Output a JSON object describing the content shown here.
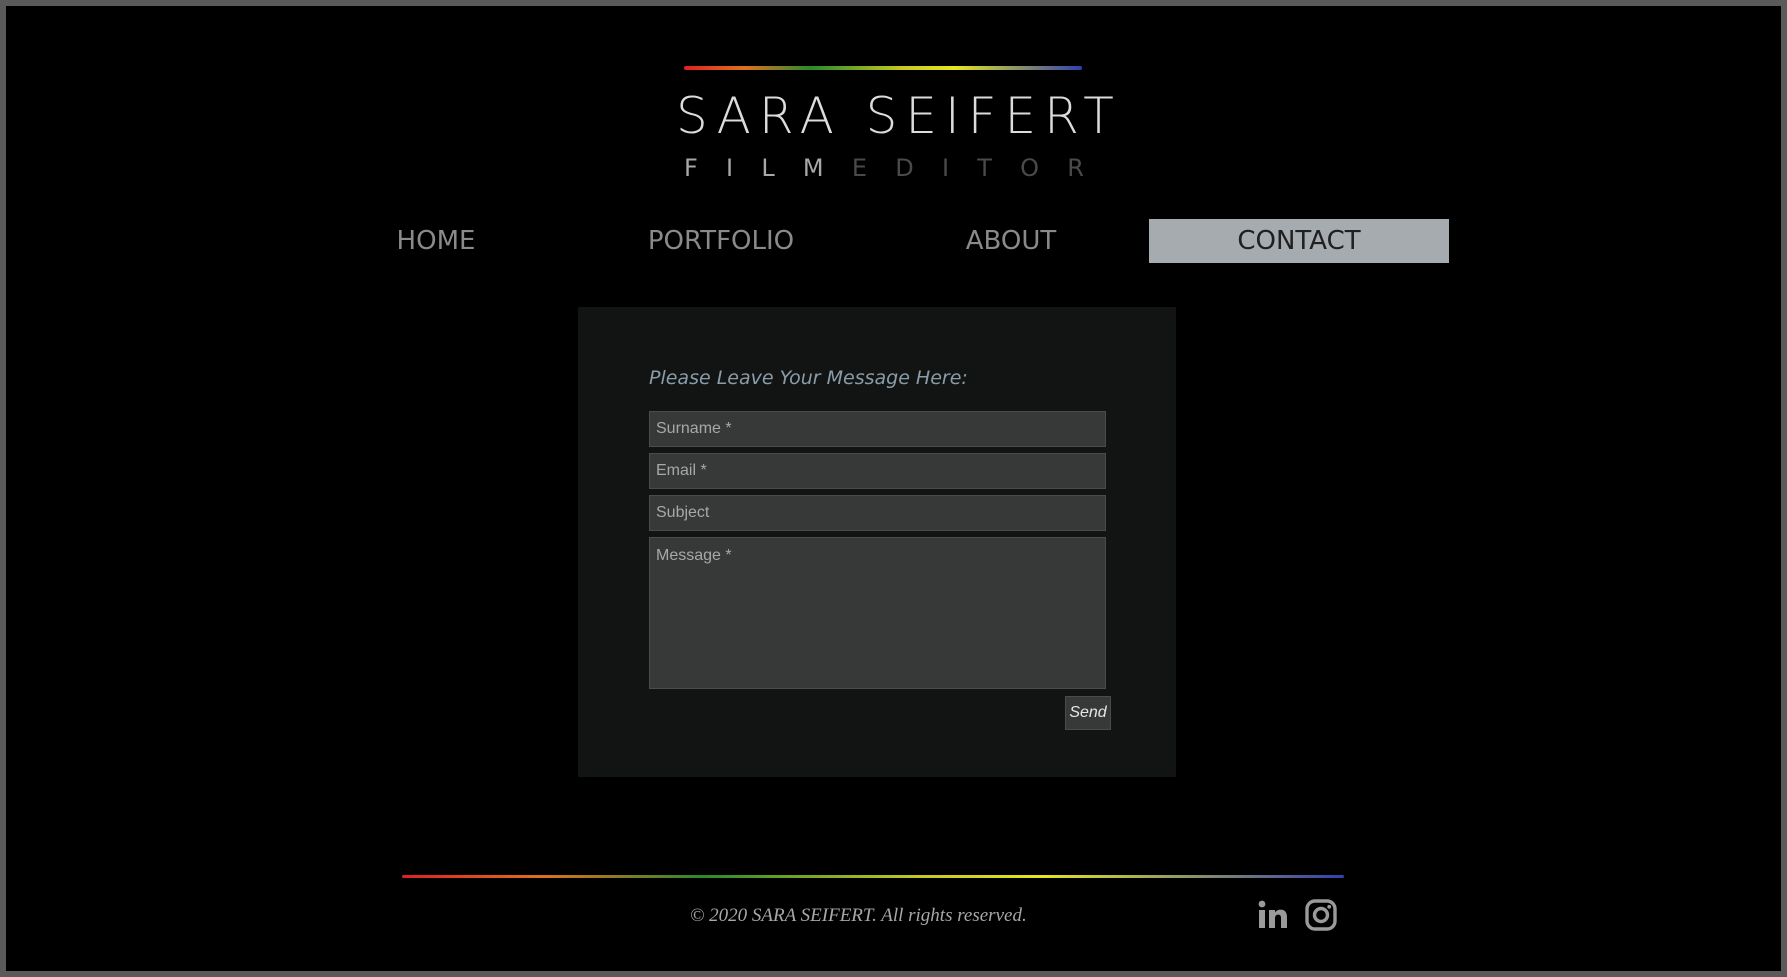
{
  "logo": {
    "name": "SARA SEIFERT",
    "subtitle_letters_film": [
      "F",
      "I",
      "L",
      "M"
    ],
    "subtitle_letters_editor": [
      "E",
      "D",
      "I",
      "T",
      "O",
      "R"
    ]
  },
  "nav": {
    "items": [
      {
        "label": "HOME",
        "active": false
      },
      {
        "label": "PORTFOLIO",
        "active": false
      },
      {
        "label": "ABOUT",
        "active": false
      },
      {
        "label": "CONTACT",
        "active": true
      }
    ]
  },
  "contact_form": {
    "title": "Please Leave Your Message Here:",
    "surname_placeholder": "Surname *",
    "email_placeholder": "Email *",
    "subject_placeholder": "Subject",
    "message_placeholder": "Message *",
    "send_label": "Send"
  },
  "footer": {
    "copyright": "© 2020 SARA SEIFERT. All rights reserved.",
    "social_icons": [
      "linkedin-icon",
      "instagram-icon"
    ]
  },
  "colors": {
    "background": "#000000",
    "active_nav": "#a6abaf",
    "form_background": "#121414",
    "field_background": "#373838"
  }
}
